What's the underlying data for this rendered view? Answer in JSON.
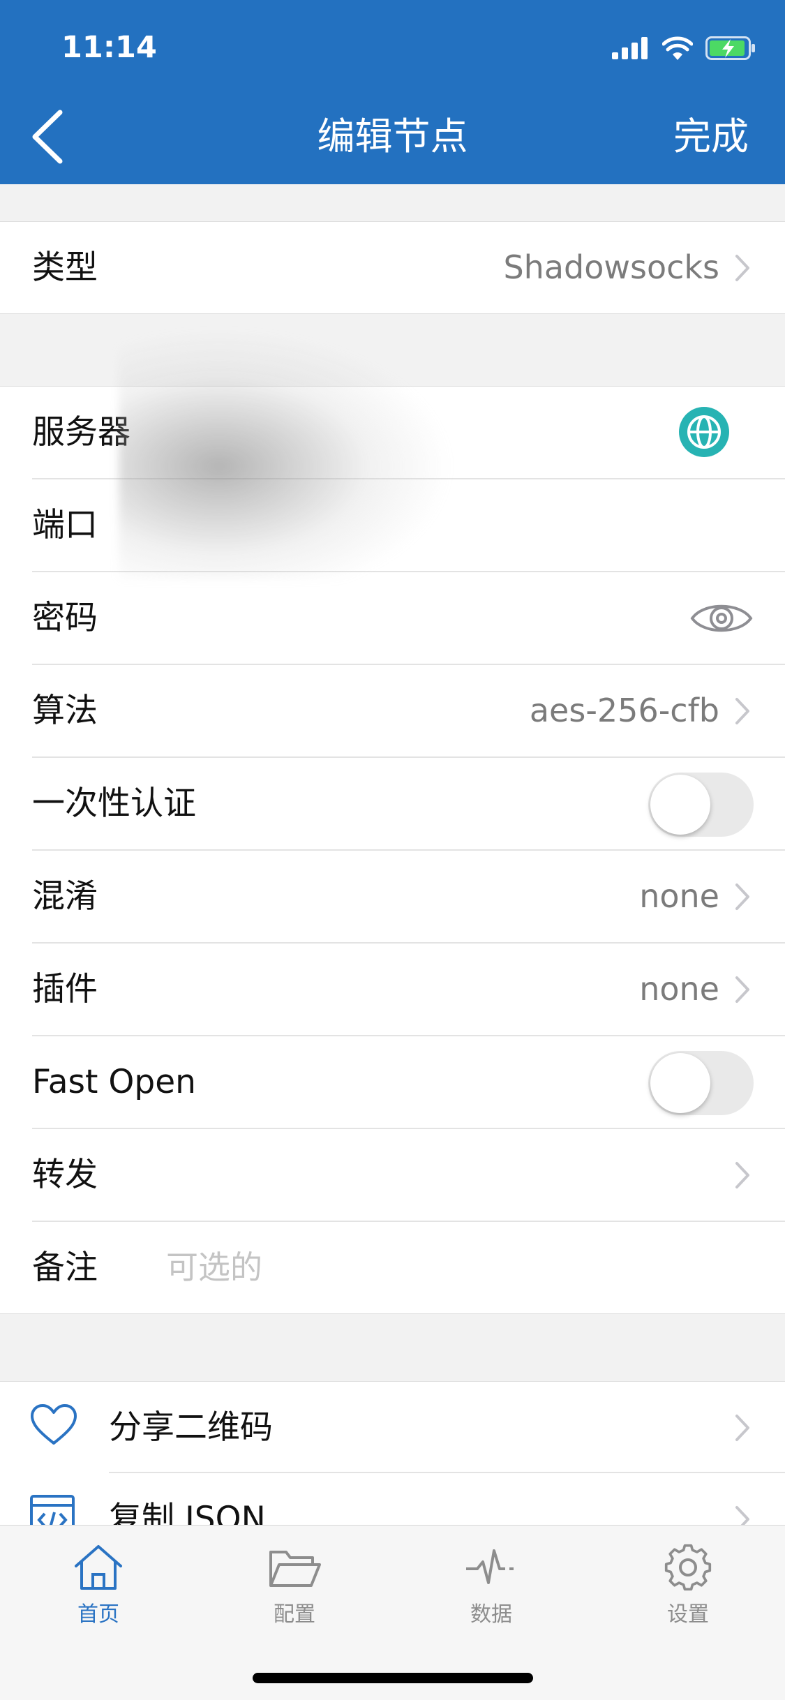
{
  "status": {
    "time": "11:14"
  },
  "nav": {
    "title": "编辑节点",
    "done": "完成"
  },
  "type_row": {
    "label": "类型",
    "value": "Shadowsocks"
  },
  "fields": {
    "server": "服务器",
    "port": "端口",
    "password": "密码",
    "cipher": {
      "label": "算法",
      "value": "aes-256-cfb"
    },
    "ota": {
      "label": "一次性认证",
      "on": false
    },
    "obfs": {
      "label": "混淆",
      "value": "none"
    },
    "plugin": {
      "label": "插件",
      "value": "none"
    },
    "fast_open": {
      "label": "Fast Open",
      "on": false
    },
    "forward": {
      "label": "转发"
    },
    "remark": {
      "label": "备注",
      "placeholder": "可选的"
    }
  },
  "actions": {
    "share_qr": "分享二维码",
    "copy_json": "复制 JSON"
  },
  "tabs": [
    {
      "label": "首页",
      "icon": "home-icon",
      "active": true
    },
    {
      "label": "配置",
      "icon": "folder-icon",
      "active": false
    },
    {
      "label": "数据",
      "icon": "activity-icon",
      "active": false
    },
    {
      "label": "设置",
      "icon": "gear-icon",
      "active": false
    }
  ],
  "colors": {
    "header": "#2371c0",
    "accent": "#2a73c3",
    "globe": "#27b3b3",
    "secondary_text": "#7b7b7b"
  }
}
